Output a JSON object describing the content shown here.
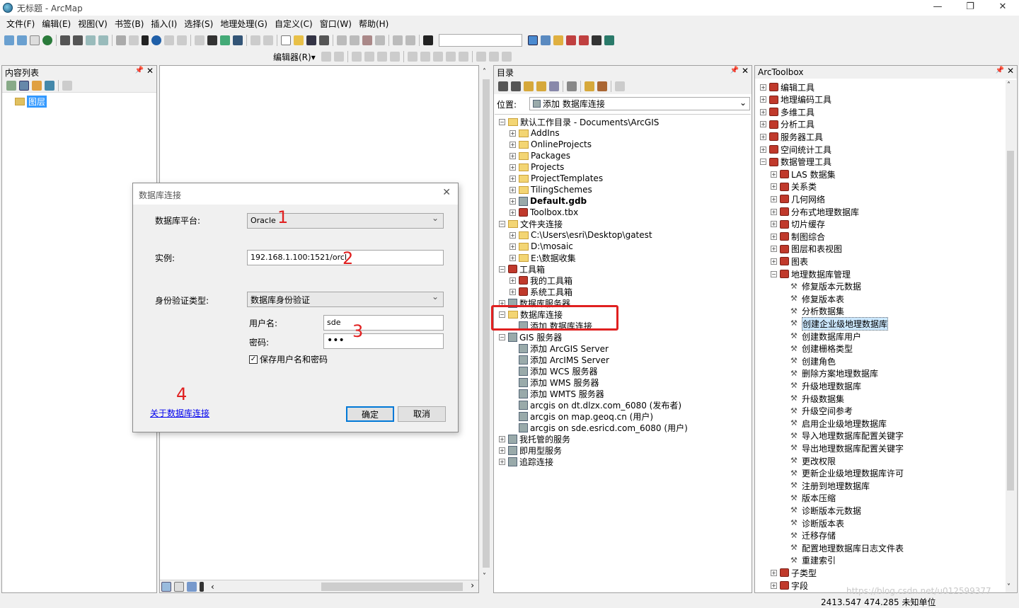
{
  "window": {
    "title": "无标题 - ArcMap",
    "min": "—",
    "max": "❐",
    "close": "✕"
  },
  "menu": [
    "文件(F)",
    "编辑(E)",
    "视图(V)",
    "书签(B)",
    "插入(I)",
    "选择(S)",
    "地理处理(G)",
    "自定义(C)",
    "窗口(W)",
    "帮助(H)"
  ],
  "editor_toolbar": {
    "label": "编辑器(R)▾"
  },
  "toc": {
    "title": "内容列表",
    "layer": "图层"
  },
  "catalog": {
    "title": "目录",
    "location_label": "位置:",
    "location_value": "添加 数据库连接",
    "items": [
      {
        "t": "默认工作目录 - Documents\\ArcGIS",
        "lvl": 0,
        "pm": "⊟",
        "ic": "folder"
      },
      {
        "t": "AddIns",
        "lvl": 1,
        "pm": "⊞",
        "ic": "folder"
      },
      {
        "t": "OnlineProjects",
        "lvl": 1,
        "pm": "⊞",
        "ic": "folder"
      },
      {
        "t": "Packages",
        "lvl": 1,
        "pm": "⊞",
        "ic": "folder"
      },
      {
        "t": "Projects",
        "lvl": 1,
        "pm": "⊞",
        "ic": "folder"
      },
      {
        "t": "ProjectTemplates",
        "lvl": 1,
        "pm": "⊞",
        "ic": "folder"
      },
      {
        "t": "TilingSchemes",
        "lvl": 1,
        "pm": "⊞",
        "ic": "folder"
      },
      {
        "t": "Default.gdb",
        "lvl": 1,
        "pm": "⊞",
        "ic": "srv",
        "bold": true
      },
      {
        "t": "Toolbox.tbx",
        "lvl": 1,
        "pm": "⊞",
        "ic": "tbox"
      },
      {
        "t": "文件夹连接",
        "lvl": 0,
        "pm": "⊟",
        "ic": "folder"
      },
      {
        "t": "C:\\Users\\esri\\Desktop\\gatest",
        "lvl": 1,
        "pm": "⊞",
        "ic": "folder"
      },
      {
        "t": "D:\\mosaic",
        "lvl": 1,
        "pm": "⊞",
        "ic": "folder"
      },
      {
        "t": "E:\\数据收集",
        "lvl": 1,
        "pm": "⊞",
        "ic": "folder"
      },
      {
        "t": "工具箱",
        "lvl": 0,
        "pm": "⊟",
        "ic": "tbox"
      },
      {
        "t": "我的工具箱",
        "lvl": 1,
        "pm": "⊞",
        "ic": "tbox"
      },
      {
        "t": "系统工具箱",
        "lvl": 1,
        "pm": "⊞",
        "ic": "tbox"
      },
      {
        "t": "数据库服务器",
        "lvl": 0,
        "pm": "⊞",
        "ic": "srv"
      },
      {
        "t": "数据库连接",
        "lvl": 0,
        "pm": "⊟",
        "ic": "folder"
      },
      {
        "t": "添加 数据库连接",
        "lvl": 1,
        "pm": "",
        "ic": "srv"
      },
      {
        "t": "GIS 服务器",
        "lvl": 0,
        "pm": "⊟",
        "ic": "srv"
      },
      {
        "t": "添加 ArcGIS Server",
        "lvl": 1,
        "pm": "",
        "ic": "srv"
      },
      {
        "t": "添加 ArcIMS Server",
        "lvl": 1,
        "pm": "",
        "ic": "srv"
      },
      {
        "t": "添加 WCS 服务器",
        "lvl": 1,
        "pm": "",
        "ic": "srv"
      },
      {
        "t": "添加 WMS 服务器",
        "lvl": 1,
        "pm": "",
        "ic": "srv"
      },
      {
        "t": "添加 WMTS 服务器",
        "lvl": 1,
        "pm": "",
        "ic": "srv"
      },
      {
        "t": "arcgis on dt.dlzx.com_6080 (发布者)",
        "lvl": 1,
        "pm": "",
        "ic": "srv"
      },
      {
        "t": "arcgis on map.geoq.cn (用户)",
        "lvl": 1,
        "pm": "",
        "ic": "srv"
      },
      {
        "t": "arcgis on sde.esricd.com_6080 (用户)",
        "lvl": 1,
        "pm": "",
        "ic": "srv"
      },
      {
        "t": "我托管的服务",
        "lvl": 0,
        "pm": "⊞",
        "ic": "srv"
      },
      {
        "t": "即用型服务",
        "lvl": 0,
        "pm": "⊞",
        "ic": "srv"
      },
      {
        "t": "追踪连接",
        "lvl": 0,
        "pm": "⊞",
        "ic": "srv"
      }
    ]
  },
  "toolbox": {
    "title": "ArcToolbox",
    "items": [
      {
        "t": "编辑工具",
        "lvl": 0,
        "pm": "⊞",
        "ic": "tbox"
      },
      {
        "t": "地理编码工具",
        "lvl": 0,
        "pm": "⊞",
        "ic": "tbox"
      },
      {
        "t": "多维工具",
        "lvl": 0,
        "pm": "⊞",
        "ic": "tbox"
      },
      {
        "t": "分析工具",
        "lvl": 0,
        "pm": "⊞",
        "ic": "tbox"
      },
      {
        "t": "服务器工具",
        "lvl": 0,
        "pm": "⊞",
        "ic": "tbox"
      },
      {
        "t": "空间统计工具",
        "lvl": 0,
        "pm": "⊞",
        "ic": "tbox"
      },
      {
        "t": "数据管理工具",
        "lvl": 0,
        "pm": "⊟",
        "ic": "tbox"
      },
      {
        "t": "LAS 数据集",
        "lvl": 1,
        "pm": "⊞",
        "ic": "tbox"
      },
      {
        "t": "关系类",
        "lvl": 1,
        "pm": "⊞",
        "ic": "tbox"
      },
      {
        "t": "几何网络",
        "lvl": 1,
        "pm": "⊞",
        "ic": "tbox"
      },
      {
        "t": "分布式地理数据库",
        "lvl": 1,
        "pm": "⊞",
        "ic": "tbox"
      },
      {
        "t": "切片缓存",
        "lvl": 1,
        "pm": "⊞",
        "ic": "tbox"
      },
      {
        "t": "制图综合",
        "lvl": 1,
        "pm": "⊞",
        "ic": "tbox"
      },
      {
        "t": "图层和表视图",
        "lvl": 1,
        "pm": "⊞",
        "ic": "tbox"
      },
      {
        "t": "图表",
        "lvl": 1,
        "pm": "⊞",
        "ic": "tbox"
      },
      {
        "t": "地理数据库管理",
        "lvl": 1,
        "pm": "⊟",
        "ic": "tbox"
      },
      {
        "t": "修复版本元数据",
        "lvl": 2,
        "pm": "",
        "ic": "hammer"
      },
      {
        "t": "修复版本表",
        "lvl": 2,
        "pm": "",
        "ic": "hammer"
      },
      {
        "t": "分析数据集",
        "lvl": 2,
        "pm": "",
        "ic": "hammer"
      },
      {
        "t": "创建企业级地理数据库",
        "lvl": 2,
        "pm": "",
        "ic": "hammer",
        "sel": true
      },
      {
        "t": "创建数据库用户",
        "lvl": 2,
        "pm": "",
        "ic": "hammer"
      },
      {
        "t": "创建栅格类型",
        "lvl": 2,
        "pm": "",
        "ic": "hammer"
      },
      {
        "t": "创建角色",
        "lvl": 2,
        "pm": "",
        "ic": "hammer"
      },
      {
        "t": "删除方案地理数据库",
        "lvl": 2,
        "pm": "",
        "ic": "hammer"
      },
      {
        "t": "升级地理数据库",
        "lvl": 2,
        "pm": "",
        "ic": "hammer"
      },
      {
        "t": "升级数据集",
        "lvl": 2,
        "pm": "",
        "ic": "hammer"
      },
      {
        "t": "升级空间参考",
        "lvl": 2,
        "pm": "",
        "ic": "hammer"
      },
      {
        "t": "启用企业级地理数据库",
        "lvl": 2,
        "pm": "",
        "ic": "hammer"
      },
      {
        "t": "导入地理数据库配置关键字",
        "lvl": 2,
        "pm": "",
        "ic": "hammer"
      },
      {
        "t": "导出地理数据库配置关键字",
        "lvl": 2,
        "pm": "",
        "ic": "hammer"
      },
      {
        "t": "更改权限",
        "lvl": 2,
        "pm": "",
        "ic": "hammer"
      },
      {
        "t": "更新企业级地理数据库许可",
        "lvl": 2,
        "pm": "",
        "ic": "hammer"
      },
      {
        "t": "注册到地理数据库",
        "lvl": 2,
        "pm": "",
        "ic": "hammer"
      },
      {
        "t": "版本压缩",
        "lvl": 2,
        "pm": "",
        "ic": "hammer"
      },
      {
        "t": "诊断版本元数据",
        "lvl": 2,
        "pm": "",
        "ic": "hammer"
      },
      {
        "t": "诊断版本表",
        "lvl": 2,
        "pm": "",
        "ic": "hammer"
      },
      {
        "t": "迁移存储",
        "lvl": 2,
        "pm": "",
        "ic": "hammer"
      },
      {
        "t": "配置地理数据库日志文件表",
        "lvl": 2,
        "pm": "",
        "ic": "hammer"
      },
      {
        "t": "重建索引",
        "lvl": 2,
        "pm": "",
        "ic": "hammer"
      },
      {
        "t": "子类型",
        "lvl": 1,
        "pm": "⊞",
        "ic": "tbox"
      },
      {
        "t": "字段",
        "lvl": 1,
        "pm": "⊞",
        "ic": "tbox"
      }
    ]
  },
  "dialog": {
    "title": "数据库连接",
    "platform_label": "数据库平台:",
    "platform_value": "Oracle",
    "instance_label": "实例:",
    "instance_value": "192.168.1.100:1521/orcl",
    "auth_label": "身份验证类型:",
    "auth_value": "数据库身份验证",
    "user_label": "用户名:",
    "user_value": "sde",
    "pwd_label": "密码:",
    "pwd_value": "•••",
    "save_label": "保存用户名和密码",
    "about_link": "关于数据库连接",
    "ok": "确定",
    "cancel": "取消",
    "close": "✕"
  },
  "annotations": [
    "1",
    "2",
    "3",
    "4"
  ],
  "status": {
    "coords": "2413.547  474.285 未知单位",
    "watermark": "https://blog.csdn.net/u012599377"
  },
  "colors": {
    "highlight_box": "#e02020",
    "link": "#0000ee",
    "selection": "#cce8ff"
  }
}
